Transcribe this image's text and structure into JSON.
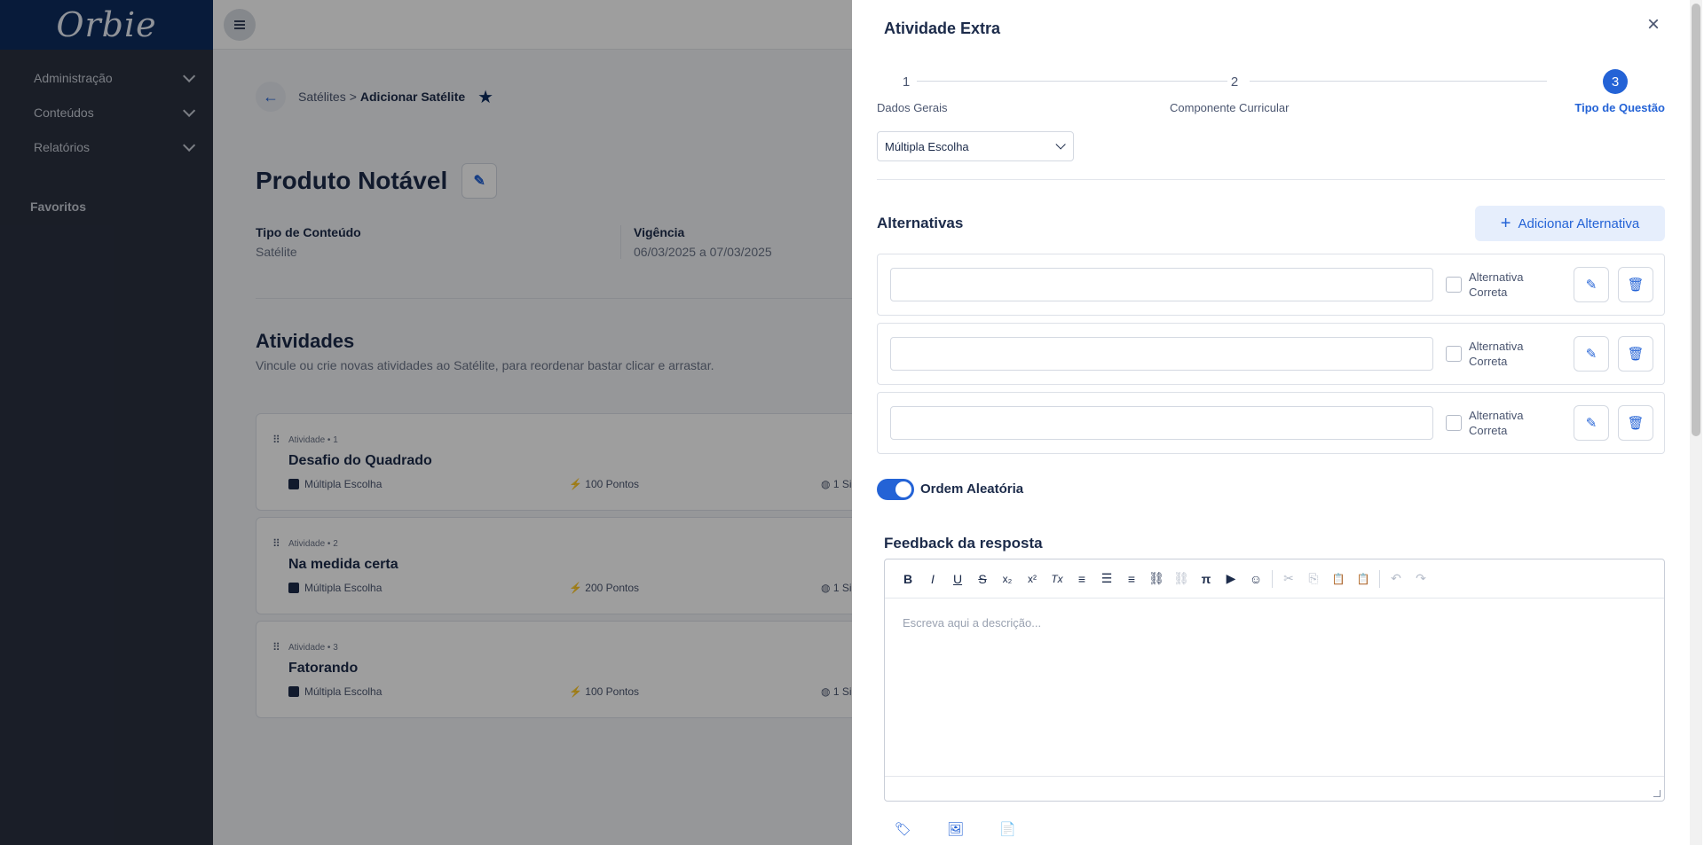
{
  "app": {
    "logo_text": "Orbie"
  },
  "sidebar": {
    "items": [
      {
        "label": "Administração"
      },
      {
        "label": "Conteúdos"
      },
      {
        "label": "Relatórios"
      }
    ],
    "favorites_label": "Favoritos"
  },
  "breadcrumb": {
    "parent": "Satélites",
    "separator": ">",
    "current": "Adicionar Satélite"
  },
  "page": {
    "title": "Produto Notável",
    "info": [
      {
        "label": "Tipo de Conteúdo",
        "value": "Satélite"
      },
      {
        "label": "Vigência",
        "value": "06/03/2025 a 07/03/2025"
      }
    ],
    "activities_title": "Atividades",
    "activities_subtitle": "Vincule ou crie novas atividades ao Satélite, para reordenar bastar clicar e arrastar.",
    "activities": [
      {
        "meta": "Atividade • 1",
        "name": "Desafio do Quadrado",
        "type": "Múltipla Escolha",
        "points": "100 Pontos",
        "extra": "1 Si"
      },
      {
        "meta": "Atividade • 2",
        "name": "Na medida certa",
        "type": "Múltipla Escolha",
        "points": "200 Pontos",
        "extra": "1 Si"
      },
      {
        "meta": "Atividade • 3",
        "name": "Fatorando",
        "type": "Múltipla Escolha",
        "points": "100 Pontos",
        "extra": "1 Si"
      }
    ]
  },
  "drawer": {
    "title": "Atividade Extra",
    "close_icon": "×",
    "steps": [
      {
        "number": "1",
        "label": "Dados Gerais",
        "active": false
      },
      {
        "number": "2",
        "label": "Componente Curricular",
        "active": false
      },
      {
        "number": "3",
        "label": "Tipo de Questão",
        "active": true
      }
    ],
    "question_type": "Múltipla Escolha",
    "alternatives_title": "Alternativas",
    "add_alternative_label": "Adicionar Alternativa",
    "alternatives": [
      {
        "value": "",
        "correct_label": "Alternativa Correta",
        "checked": false
      },
      {
        "value": "",
        "correct_label": "Alternativa Correta",
        "checked": false
      },
      {
        "value": "",
        "correct_label": "Alternativa Correta",
        "checked": false
      }
    ],
    "random_order_label": "Ordem Aleatória",
    "random_order_on": true,
    "feedback_title": "Feedback da resposta",
    "editor_placeholder": "Escreva aqui a descrição...",
    "toolbar": [
      {
        "icon": "bold-icon",
        "glyph": "B"
      },
      {
        "icon": "italic-icon",
        "glyph": "I"
      },
      {
        "icon": "underline-icon",
        "glyph": "U"
      },
      {
        "icon": "strikethrough-icon",
        "glyph": "S"
      },
      {
        "icon": "subscript-icon",
        "glyph": "x₂"
      },
      {
        "icon": "superscript-icon",
        "glyph": "x²"
      },
      {
        "icon": "clear-format-icon",
        "glyph": "Tx"
      },
      {
        "icon": "numbered-list-icon",
        "glyph": "≡"
      },
      {
        "icon": "bullet-list-icon",
        "glyph": "☰"
      },
      {
        "icon": "align-icon",
        "glyph": "≡"
      },
      {
        "icon": "link-icon",
        "glyph": "⛓"
      },
      {
        "icon": "unlink-icon",
        "glyph": "⛓"
      },
      {
        "icon": "formula-icon",
        "glyph": "π"
      },
      {
        "icon": "video-icon",
        "glyph": "▶"
      },
      {
        "icon": "emoji-icon",
        "glyph": "☺"
      },
      {
        "icon": "cut-icon",
        "glyph": "✂"
      },
      {
        "icon": "copy-icon",
        "glyph": "⎘"
      },
      {
        "icon": "paste-icon",
        "glyph": "📋"
      },
      {
        "icon": "paste-text-icon",
        "glyph": "📋"
      },
      {
        "icon": "undo-icon",
        "glyph": "↶"
      },
      {
        "icon": "redo-icon",
        "glyph": "↷"
      }
    ]
  },
  "colors": {
    "accent": "#2463d6",
    "sidebar": "#2a3140",
    "brand": "#0d2c5e"
  }
}
